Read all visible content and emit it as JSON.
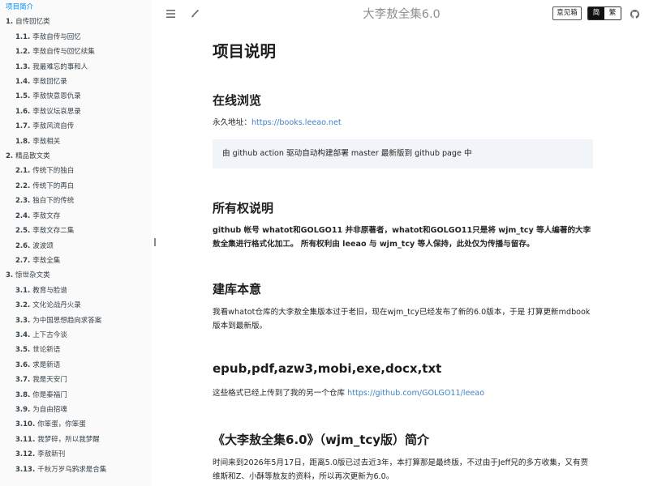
{
  "sidebar": {
    "items": [
      {
        "num": "",
        "label": "项目简介",
        "level": 0,
        "active": true
      },
      {
        "num": "1.",
        "label": "自传回忆类",
        "level": 0
      },
      {
        "num": "1.1.",
        "label": "李敖自传与回忆",
        "level": 1
      },
      {
        "num": "1.2.",
        "label": "李敖自传与回忆续集",
        "level": 1
      },
      {
        "num": "1.3.",
        "label": "我最难忘的事和人",
        "level": 1
      },
      {
        "num": "1.4.",
        "label": "李敖回忆录",
        "level": 1
      },
      {
        "num": "1.5.",
        "label": "李敖快意恩仇录",
        "level": 1
      },
      {
        "num": "1.6.",
        "label": "李敖议坛哀思录",
        "level": 1
      },
      {
        "num": "1.7.",
        "label": "李敖风流自传",
        "level": 1
      },
      {
        "num": "1.8.",
        "label": "李敖相关",
        "level": 1
      },
      {
        "num": "2.",
        "label": "精品散文类",
        "level": 0
      },
      {
        "num": "2.1.",
        "label": "传统下的独白",
        "level": 1
      },
      {
        "num": "2.2.",
        "label": "传统下的再白",
        "level": 1
      },
      {
        "num": "2.3.",
        "label": "独白下的传统",
        "level": 1
      },
      {
        "num": "2.4.",
        "label": "李敖文存",
        "level": 1
      },
      {
        "num": "2.5.",
        "label": "李敖文存二集",
        "level": 1
      },
      {
        "num": "2.6.",
        "label": "波波颂",
        "level": 1
      },
      {
        "num": "2.7.",
        "label": "李敖全集",
        "level": 1
      },
      {
        "num": "3.",
        "label": "惊世杂文类",
        "level": 0
      },
      {
        "num": "3.1.",
        "label": "教育与脸谱",
        "level": 1
      },
      {
        "num": "3.2.",
        "label": "文化论战丹火录",
        "level": 1
      },
      {
        "num": "3.3.",
        "label": "为中国思想趋向求答案",
        "level": 1
      },
      {
        "num": "3.4.",
        "label": "上下古今谈",
        "level": 1
      },
      {
        "num": "3.5.",
        "label": "世论新语",
        "level": 1
      },
      {
        "num": "3.6.",
        "label": "求是新语",
        "level": 1
      },
      {
        "num": "3.7.",
        "label": "我是天安门",
        "level": 1
      },
      {
        "num": "3.8.",
        "label": "你是秦福门",
        "level": 1
      },
      {
        "num": "3.9.",
        "label": "为自由招魂",
        "level": 1
      },
      {
        "num": "3.10.",
        "label": "你笨蛋，你笨蛋",
        "level": 1
      },
      {
        "num": "3.11.",
        "label": "我梦碎，所以我梦醒",
        "level": 1
      },
      {
        "num": "3.12.",
        "label": "李敖新刊",
        "level": 1
      },
      {
        "num": "3.13.",
        "label": "千秋万岁乌鸦求是合集",
        "level": 1
      }
    ]
  },
  "menubar": {
    "title": "大李敖全集6.0",
    "hamburger_icon": "hamburger-icon",
    "theme_icon": "paintbrush-icon",
    "feedback_label": "意见箱",
    "lang_simplified": "简",
    "lang_traditional": "繁",
    "github_icon": "github-icon"
  },
  "content": {
    "h1": "项目说明",
    "s1_title": "在线浏览",
    "s1_prefix": "永久地址：",
    "s1_link": "https://books.leeao.net",
    "s1_quote": "由 github action 驱动自动构建部署 master 最新版到 github page 中",
    "s2_title": "所有权说明",
    "s2_text": "github 帐号 whatot和GOLGO11 并非原著者，whatot和GOLGO11只是将 wjm_tcy 等人编著的大李敖全集进行格式化加工。 所有权利由 leeao 与 wjm_tcy 等人保持，此处仅为传播与留存。",
    "s3_title": "建库本意",
    "s3_text": "我看whatot仓库的大李敖全集版本过于老旧，现在wjm_tcy已经发布了新的6.0版本，于是 打算更新mdbook版本到最新版。",
    "s4_title": "epub,pdf,azw3,mobi,exe,docx,txt",
    "s4_prefix": "这些格式已经上传到了我的另一个仓库 ",
    "s4_link": "https://github.com/GOLGO11/leeao",
    "s5_title": "《大李敖全集6.0》（wjm_tcy版）简介",
    "s5_text": "时间来到2026年5月17日，距离5.0版已过去近3年，本打算那是最终版，不过由于Jeff兄的多方收集，又有贾维斯和Z、小酥等敖友的资料，所以再次更新为6.0。"
  },
  "colors": {
    "link": "#4183c4",
    "active_toc": "#008cff",
    "sidebar_bg": "#fafafa",
    "quote_bg": "#f1f4f8"
  }
}
